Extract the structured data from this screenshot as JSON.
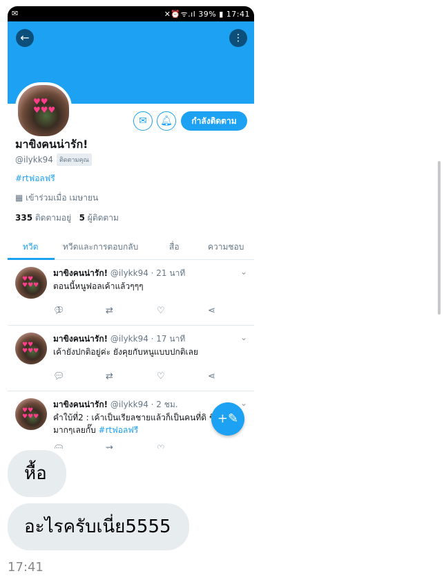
{
  "statusbar": {
    "left_icon": "mail-icon",
    "signals": "✕⏰ᯤ.ıl",
    "battery": "39%",
    "time": "17:41"
  },
  "header": {
    "back_icon": "arrow-left-icon",
    "more_icon": "more-vertical-icon",
    "banner_color": "#1da1f2"
  },
  "profile": {
    "name": "มาขิงคนน่ารัก!",
    "handle": "@ilykk94",
    "follows_you": "ติดตามคุณ",
    "bio_hashtag": "#rtฟอลฟรี",
    "joined": "เข้าร่วมเมื่อ เมษายน",
    "following_count": "335",
    "following_label": "ติดตามอยู่",
    "followers_count": "5",
    "followers_label": "ผู้ติดตาม",
    "follow_button": "กำลังติดตาม"
  },
  "tabs": [
    "ทวีต",
    "ทวีตและการตอบกลับ",
    "สื่อ",
    "ความชอบ"
  ],
  "tweets": [
    {
      "name": "มาขิงคนน่ารัก!",
      "meta": "@ilykk94 · 21 นาที",
      "text": "ตอนนี้หนูฟอลเค้าแล้วๆๆๆ",
      "tag": "",
      "reply_count": "1",
      "retweet_count": "",
      "like_count": ""
    },
    {
      "name": "มาขิงคนน่ารัก!",
      "meta": "@ilykk94 · 17 นาที",
      "text": "เค้ายังปกติอยู่ค่ะ ยังคุยกับหนูแบบปกติเลย",
      "tag": "",
      "reply_count": "",
      "retweet_count": "",
      "like_count": ""
    },
    {
      "name": "มาขิงคนน่ารัก!",
      "meta": "@ilykk94 · 2 ชม.",
      "text": "คำใบ้ที่2 : เค้าเป็นเรียลชายแล้วก็เป็นคนที่ดิ ชิพมากๆเลยกั๊บ ",
      "tag": "#rtฟอลฟรี",
      "reply_count": "",
      "retweet_count": "",
      "like_count": ""
    }
  ],
  "chat": {
    "messages": [
      "หื้อ",
      "อะไรครับเนี่ย5555"
    ],
    "time": "17:41"
  }
}
